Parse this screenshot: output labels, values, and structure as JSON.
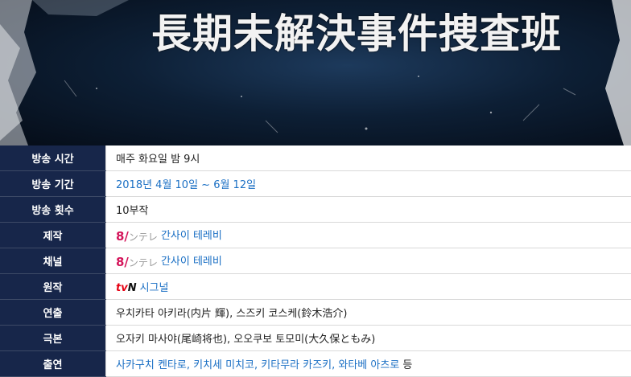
{
  "banner": {
    "title": "長期未解決事件捜査班"
  },
  "rows": [
    {
      "label": "방송 시간",
      "value": "매주 화요일 밤 9시",
      "link": false
    },
    {
      "label": "방송 기간",
      "value": "2018년 4월 10일 ~ 6월 12일",
      "link": true
    },
    {
      "label": "방송 횟수",
      "value": "10부작",
      "link": false
    },
    {
      "label": "제작",
      "logo_mark": "8/",
      "logo_text": "ンテレ",
      "value": "간사이 테레비",
      "link": true
    },
    {
      "label": "채널",
      "logo_mark": "8/",
      "logo_text": "ンテレ",
      "value": "간사이 테레비",
      "link": true
    },
    {
      "label": "원작",
      "logo_r": "tv",
      "logo_b": "N",
      "value": "시그널",
      "link": true
    },
    {
      "label": "연출",
      "value": "우치카타 아키라(内片 輝), 스즈키 코스케(鈴木浩介)",
      "link": false
    },
    {
      "label": "극본",
      "value": "오자키 마사야(尾崎将也), 오오쿠보 토모미(大久保ともみ)",
      "link": false
    },
    {
      "label": "출연",
      "value_links": "사카구치 켄타로, 키치세 미치코, 키타무라 카즈키, 와타베 아츠로",
      "value_suffix": " 등"
    }
  ]
}
